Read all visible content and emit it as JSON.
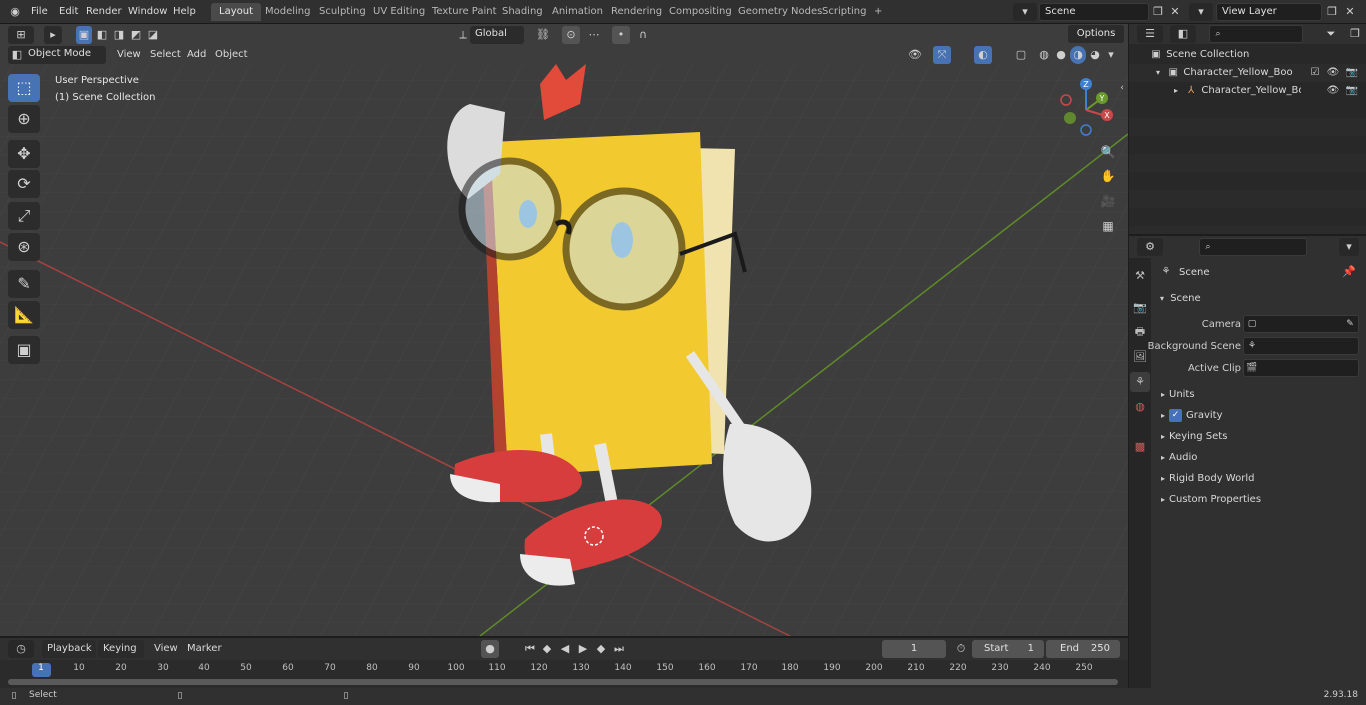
{
  "topbar": {
    "menus": [
      "File",
      "Edit",
      "Render",
      "Window",
      "Help"
    ],
    "workspaces": [
      "Layout",
      "Modeling",
      "Sculpting",
      "UV Editing",
      "Texture Paint",
      "Shading",
      "Animation",
      "Rendering",
      "Compositing",
      "Geometry Nodes",
      "Scripting"
    ],
    "active_workspace": "Layout",
    "add_workspace": "+",
    "scene_name": "Scene",
    "view_layer": "View Layer"
  },
  "viewport": {
    "mode": "Object Mode",
    "menus": [
      "View",
      "Select",
      "Add",
      "Object"
    ],
    "transform_orientation": "Global",
    "options_label": "Options",
    "overlay_title": "User Perspective",
    "overlay_collection": "(1) Scene Collection",
    "gizmo_axes": {
      "x": "X",
      "y": "Y",
      "z": "Z"
    },
    "colors": {
      "x_axis": "#c8494a",
      "y_axis": "#6a9a2c",
      "z_axis": "#3f80d1",
      "active": "#4772b3",
      "background": "#3d3d3d"
    }
  },
  "outliner": {
    "search_placeholder": "",
    "root": "Scene Collection",
    "items": [
      {
        "label": "Character_Yellow_Book_Thin"
      },
      {
        "label": "Character_Yellow_Book_"
      }
    ]
  },
  "properties": {
    "context_title": "Scene",
    "panel_title": "Scene",
    "fields": [
      {
        "label": "Camera",
        "value": ""
      },
      {
        "label": "Background Scene",
        "value": ""
      },
      {
        "label": "Active Clip",
        "value": ""
      }
    ],
    "subpanels": [
      "Units",
      "Gravity",
      "Keying Sets",
      "Audio",
      "Rigid Body World",
      "Custom Properties"
    ],
    "gravity_checked": true
  },
  "timeline": {
    "menus": [
      "Playback",
      "Keying",
      "View",
      "Marker"
    ],
    "current_frame": "1",
    "start_label": "Start",
    "start_value": "1",
    "end_label": "End",
    "end_value": "250",
    "ticks": [
      "1",
      "10",
      "20",
      "30",
      "40",
      "50",
      "60",
      "70",
      "80",
      "90",
      "100",
      "110",
      "120",
      "130",
      "140",
      "150",
      "160",
      "170",
      "180",
      "190",
      "200",
      "210",
      "220",
      "230",
      "240",
      "250"
    ]
  },
  "status": {
    "left_label": "Select",
    "version": "2.93.18"
  }
}
